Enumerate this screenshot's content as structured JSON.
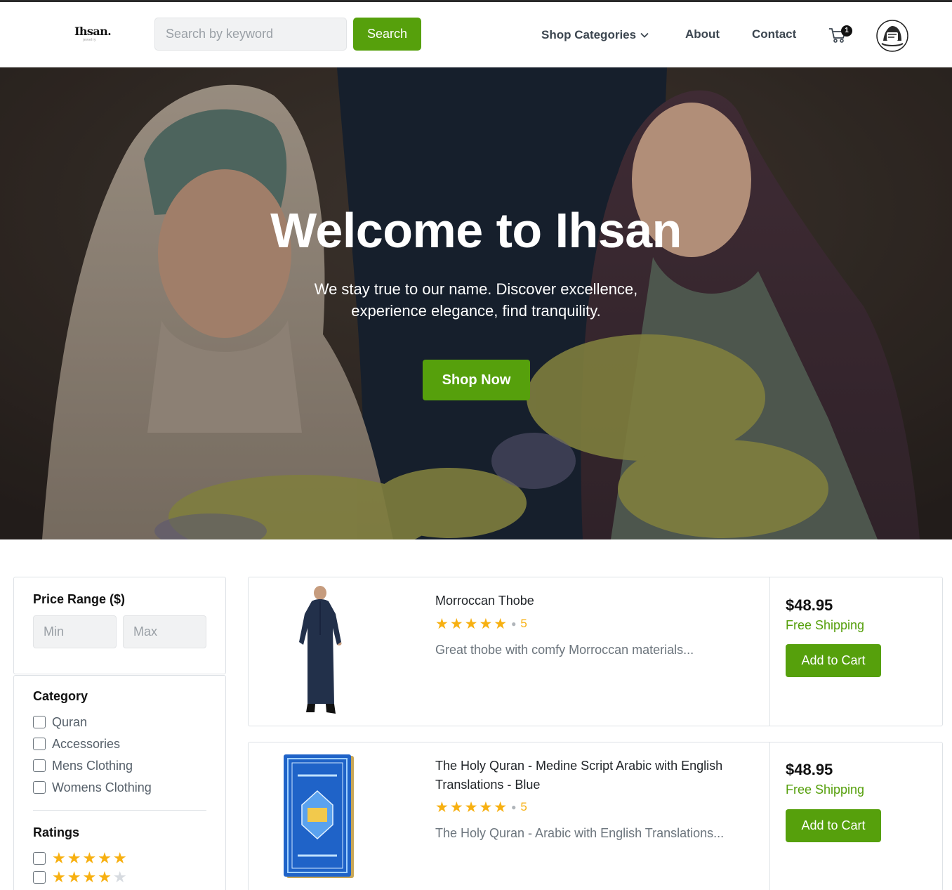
{
  "brand": {
    "name": "Ihsan.",
    "tagline": "jewelry"
  },
  "header": {
    "search_placeholder": "Search by keyword",
    "search_button": "Search",
    "nav": {
      "shop_categories": "Shop Categories",
      "about": "About",
      "contact": "Contact"
    },
    "cart_count": "1",
    "icons": {
      "cart": "cart-icon",
      "caret": "chevron-down-icon",
      "avatar": "user-avatar"
    }
  },
  "hero": {
    "title": "Welcome to Ihsan",
    "subtitle_line1": "We stay true to our name. Discover excellence,",
    "subtitle_line2": "experience elegance, find tranquility.",
    "button": "Shop Now"
  },
  "filters": {
    "price": {
      "title": "Price Range ($)",
      "min_placeholder": "Min",
      "max_placeholder": "Max"
    },
    "category": {
      "title": "Category",
      "options": [
        "Quran",
        "Accessories",
        "Mens Clothing",
        "Womens Clothing"
      ]
    },
    "ratings": {
      "title": "Ratings",
      "options": [
        5,
        4
      ]
    }
  },
  "products": [
    {
      "title": "Morroccan Thobe",
      "rating": 5,
      "rating_count": "5",
      "description": "Great thobe with comfy Morroccan materials...",
      "price": "$48.95",
      "shipping": "Free Shipping",
      "button": "Add to Cart"
    },
    {
      "title": "The Holy Quran - Medine Script Arabic with English Translations - Blue",
      "rating": 5,
      "rating_count": "5",
      "description": "The Holy Quran - Arabic with English Translations...",
      "price": "$48.95",
      "shipping": "Free Shipping",
      "button": "Add to Cart"
    }
  ],
  "colors": {
    "accent": "#56a00c",
    "star": "#f7b011",
    "star_off": "#d7dbe0",
    "text_muted": "#6c757d"
  }
}
